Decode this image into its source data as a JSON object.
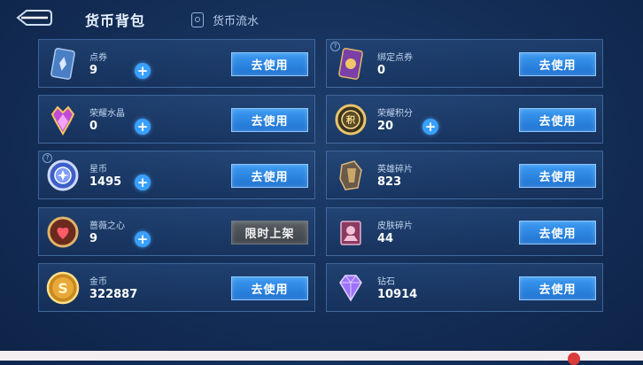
{
  "header": {
    "title": "货币背包",
    "flow_tab": "货币流水"
  },
  "cards": [
    {
      "name": "点券",
      "amount": "9",
      "has_plus": true,
      "button": "去使用",
      "button_type": "use",
      "icon": "coupon-card-icon",
      "badge": false
    },
    {
      "name": "绑定点券",
      "amount": "0",
      "has_plus": false,
      "button": "去使用",
      "button_type": "use",
      "icon": "bound-coupon-card-icon",
      "badge": true
    },
    {
      "name": "荣耀水晶",
      "amount": "0",
      "has_plus": true,
      "button": "去使用",
      "button_type": "use",
      "icon": "glory-crystal-icon",
      "badge": false
    },
    {
      "name": "荣耀积分",
      "amount": "20",
      "has_plus": true,
      "button": "去使用",
      "button_type": "use",
      "icon": "glory-points-icon",
      "badge": false
    },
    {
      "name": "星币",
      "amount": "1495",
      "has_plus": true,
      "button": "去使用",
      "button_type": "use",
      "icon": "star-coin-icon",
      "badge": true
    },
    {
      "name": "英雄碎片",
      "amount": "823",
      "has_plus": false,
      "button": "去使用",
      "button_type": "use",
      "icon": "hero-fragment-icon",
      "badge": false
    },
    {
      "name": "蔷薇之心",
      "amount": "9",
      "has_plus": true,
      "button": "限时上架",
      "button_type": "limited",
      "icon": "rose-heart-icon",
      "badge": false
    },
    {
      "name": "皮肤碎片",
      "amount": "44",
      "has_plus": false,
      "button": "去使用",
      "button_type": "use",
      "icon": "skin-fragment-icon",
      "badge": false
    },
    {
      "name": "金币",
      "amount": "322887",
      "has_plus": false,
      "button": "去使用",
      "button_type": "use",
      "icon": "gold-coin-icon",
      "badge": false
    },
    {
      "name": "钻石",
      "amount": "10914",
      "has_plus": false,
      "button": "去使用",
      "button_type": "use",
      "icon": "diamond-icon",
      "badge": false
    }
  ],
  "colors": {
    "accent_blue": "#3aa0ff",
    "button_blue": "#2a85e0",
    "limited_gray": "#4b5057",
    "background": "#15305a"
  }
}
